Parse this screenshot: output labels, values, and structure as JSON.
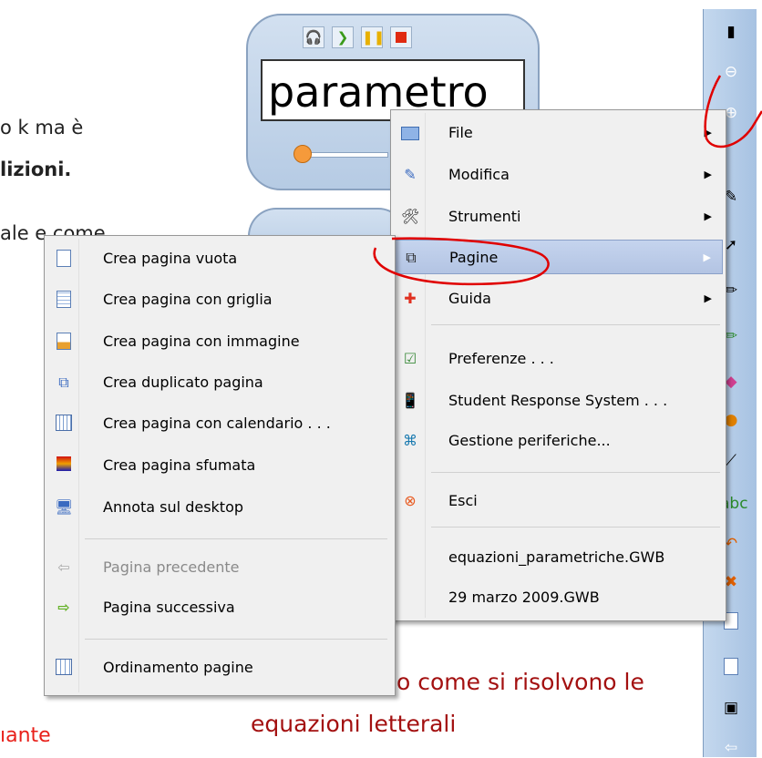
{
  "background": {
    "line1": "o k ma è",
    "line2": "lizioni.",
    "line3": "ale e come",
    "red_text_1": "o come si risolvono le",
    "red_text_2": "equazioni letterali",
    "bottom_left": "ıante"
  },
  "widget": {
    "word": "parametro",
    "buttons": [
      "headphones-icon",
      "play-icon",
      "pause-icon",
      "stop-icon"
    ]
  },
  "main_menu": {
    "items": [
      {
        "label": "File",
        "icon": "folder-icon",
        "submenu": true
      },
      {
        "label": "Modifica",
        "icon": "edit-icon",
        "submenu": true
      },
      {
        "label": "Strumenti",
        "icon": "tools-icon",
        "submenu": true
      },
      {
        "label": "Pagine",
        "icon": "pages-icon",
        "submenu": true,
        "highlighted": true
      },
      {
        "label": "Guida",
        "icon": "help-icon",
        "submenu": true
      },
      {
        "label": "Preferenze . . .",
        "icon": "preferences-icon"
      },
      {
        "label": "Student Response System . . .",
        "icon": "response-system-icon"
      },
      {
        "label": "Gestione periferiche...",
        "icon": "devices-icon"
      },
      {
        "label": "Esci",
        "icon": "exit-icon"
      },
      {
        "label": "equazioni_parametriche.GWB"
      },
      {
        "label": "29 marzo 2009.GWB"
      }
    ]
  },
  "pages_submenu": {
    "items": [
      {
        "label": "Crea pagina vuota",
        "icon": "blank-page-icon"
      },
      {
        "label": "Crea pagina con griglia",
        "icon": "grid-page-icon"
      },
      {
        "label": "Crea pagina con immagine",
        "icon": "image-page-icon"
      },
      {
        "label": "Crea duplicato pagina",
        "icon": "duplicate-page-icon"
      },
      {
        "label": "Crea pagina con calendario . . .",
        "icon": "calendar-page-icon"
      },
      {
        "label": "Crea pagina sfumata",
        "icon": "gradient-page-icon"
      },
      {
        "label": "Annota sul desktop",
        "icon": "annotate-desktop-icon"
      },
      {
        "label": "Pagina precedente",
        "icon": "arrow-left-icon",
        "disabled": true
      },
      {
        "label": "Pagina successiva",
        "icon": "arrow-right-icon"
      },
      {
        "label": "Ordinamento pagine",
        "icon": "page-sorter-icon"
      }
    ]
  },
  "colors": {
    "highlight": "#b9c9e8",
    "menu_bg": "#f0f0f0",
    "annotation_red": "#e00000",
    "toolbar": "#b6cde8",
    "red_text": "#a31010"
  }
}
